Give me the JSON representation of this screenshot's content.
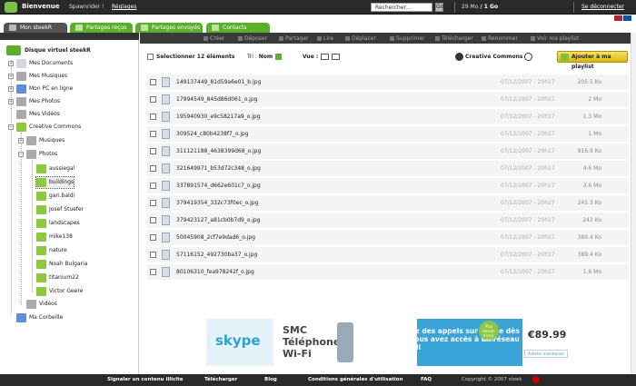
{
  "header": {
    "welcome": "Bienvenue",
    "username": "Spawnrider !",
    "settings": "Réglages",
    "search_placeholder": "Rechercher...",
    "search_btn": "Go",
    "quota_used": "29 Mo",
    "quota_total": " / 1 Go",
    "logout": "Se déconnecter"
  },
  "tabs": [
    {
      "label": "Mon steekR"
    },
    {
      "label": "Partages reçus"
    },
    {
      "label": "Partages envoyés"
    },
    {
      "label": "Contacts"
    }
  ],
  "toolbar": {
    "items": [
      "Créer",
      "Déposer",
      "Partager",
      "Lire",
      "Déplacer",
      "Supprimer",
      "Télécharger",
      "Renommer",
      "Voir ma playlist"
    ]
  },
  "sidebar": {
    "root": "Disque virtuel steekR",
    "items": [
      "Mes Documents",
      "Mes Musiques",
      "Mon PC en ligne",
      "Mes Photos",
      "Mes Vidéos",
      "Creative Commons",
      "Musiques",
      "Photos",
      "aussiegal",
      "buildings",
      "gari.baldi",
      "Josef Stuefer",
      "landscapes",
      "mike138",
      "nature",
      "Noah Bulgaria",
      "titanium22",
      "Victor Geere",
      "Vidéos",
      "Ma Corbeille"
    ]
  },
  "content": {
    "select_all": "Selectionner 12 éléments",
    "sort_label": "Tri : ",
    "sort_value": "Nom",
    "view_label": "Vue :",
    "cc_label": "Creative Commons",
    "add_playlist": "Ajouter à ma playlist",
    "files": [
      {
        "name": "149137449_81d59a6e01_b.jpg",
        "date": "07/12/2007 - 20h17",
        "size": "205.5 Ko"
      },
      {
        "name": "17994549_845d86d061_o.jpg",
        "date": "07/12/2007 - 20h17",
        "size": "2 Mo"
      },
      {
        "name": "195940930_e9c58217a9_o.jpg",
        "date": "07/12/2007 - 20h17",
        "size": "1.3 Mo"
      },
      {
        "name": "309524_c80b4238f7_o.jpg",
        "date": "07/12/2007 - 20h17",
        "size": "1 Mo"
      },
      {
        "name": "311121188_4638399d68_o.jpg",
        "date": "07/12/2007 - 20h17",
        "size": "916.9 Ko"
      },
      {
        "name": "321649971_b53d72c348_o.jpg",
        "date": "07/12/2007 - 20h17",
        "size": "4.6 Mo"
      },
      {
        "name": "337891574_d662e601c7_o.jpg",
        "date": "07/12/2007 - 20h17",
        "size": "3.6 Mo"
      },
      {
        "name": "379419354_332c73f0ec_o.jpg",
        "date": "07/12/2007 - 20h17",
        "size": "245.3 Ko"
      },
      {
        "name": "379423127_a81cb0b7d9_o.jpg",
        "date": "07/12/2007 - 20h17",
        "size": "242 Ko"
      },
      {
        "name": "50045908_2cf7e9dad6_o.jpg",
        "date": "07/12/2007 - 20h17",
        "size": "389.4 Ko"
      },
      {
        "name": "57116152_492730ba37_o.jpg",
        "date": "07/12/2007 - 20h17",
        "size": "389.4 Ko"
      },
      {
        "name": "80106310_fea978242f_o.jpg",
        "date": "07/12/2007 - 20h17",
        "size": "1.6 Mo"
      }
    ]
  },
  "ad": {
    "brand": "skype",
    "product": "SMC Téléphone Wi-Fi",
    "message": "Passez des appels sur Skype dès que vous avez accès à un réseau sans fil",
    "badge": "Plus besoin d'ordi- nateur",
    "price": "€89.99",
    "buy": "Acheter maintenant"
  },
  "footer": {
    "links": [
      "Signaler un contenu illicite",
      "Télécharger",
      "Blog",
      "Conditions générales d'utilisation",
      "FAQ"
    ],
    "copyright": "Copyright © 2007 steek"
  },
  "colors": {
    "accent": "#5bb02b",
    "dark": "#2a2a2a",
    "playlist": "#e6cc20"
  }
}
